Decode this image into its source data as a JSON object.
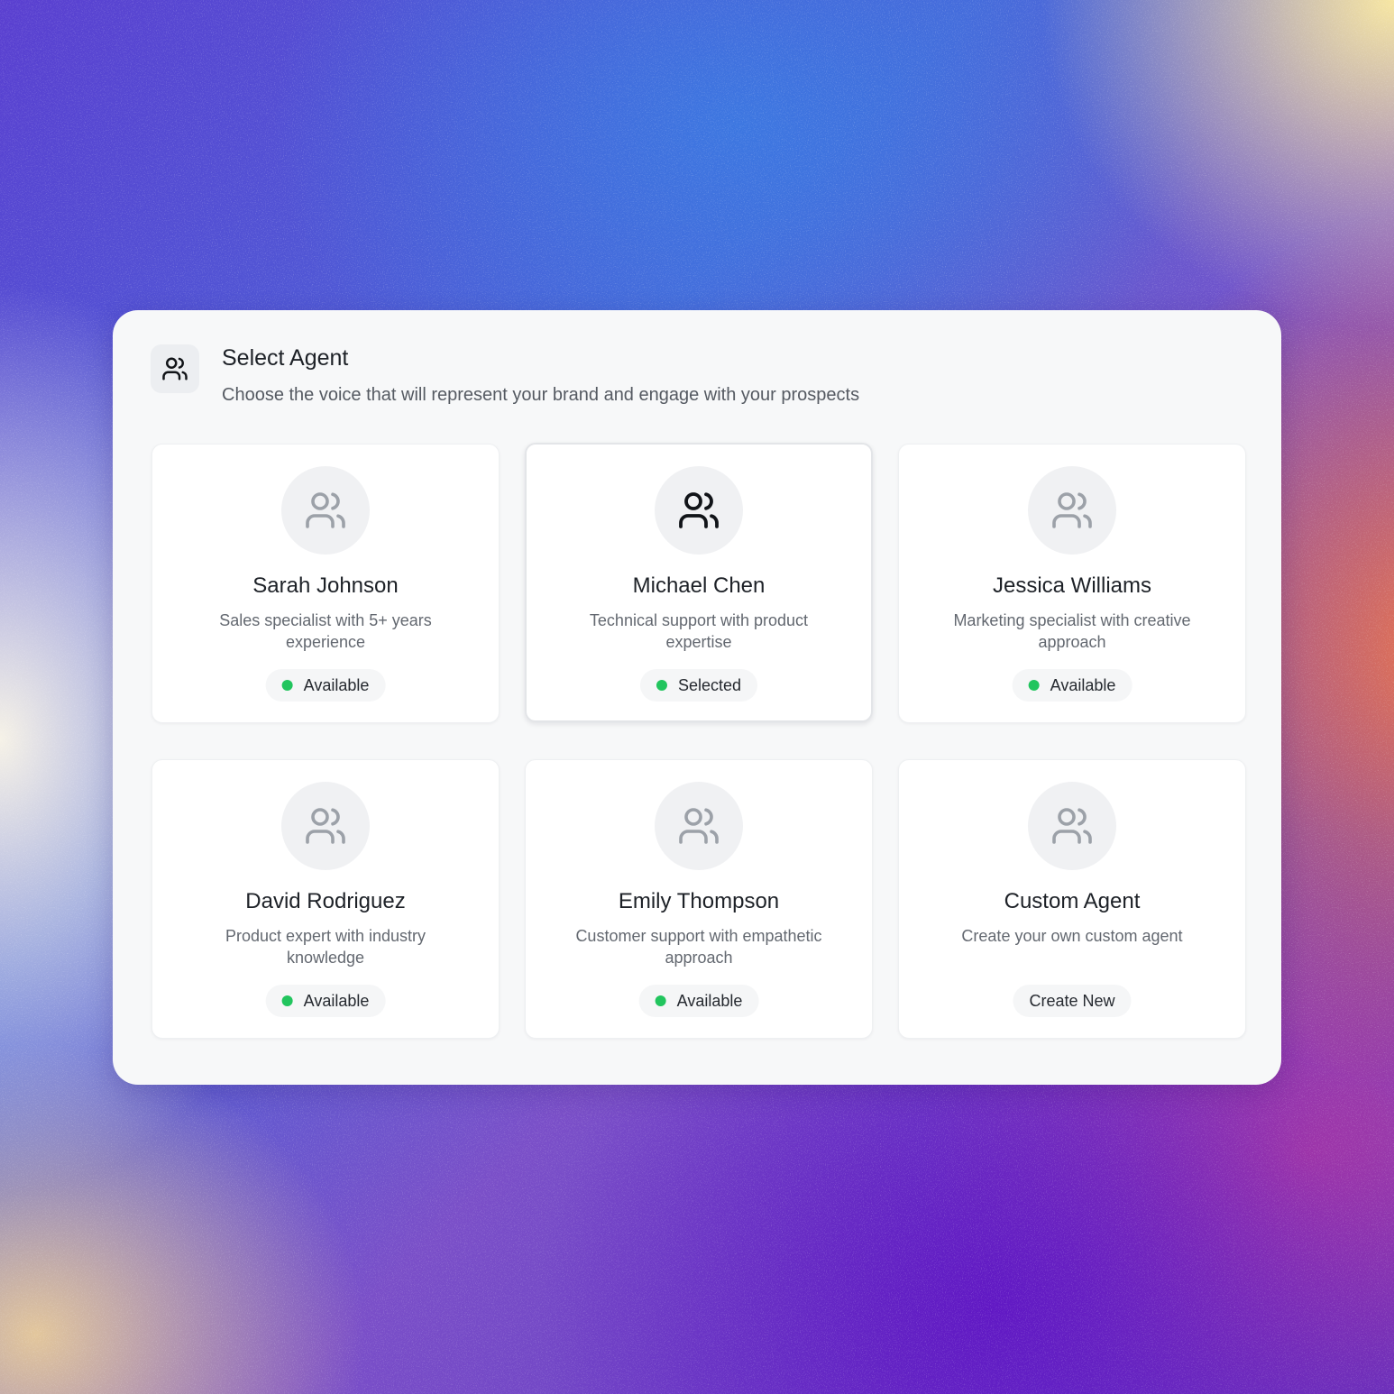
{
  "header": {
    "icon": "users-icon",
    "title": "Select Agent",
    "subtitle": "Choose the voice that will represent your brand and engage with your prospects"
  },
  "colors": {
    "status_dot": "#22c55e",
    "icon_muted": "#9ca1a8",
    "icon_active": "#111418"
  },
  "agents": [
    {
      "name": "Sarah Johnson",
      "description": "Sales specialist with 5+ years experience",
      "status": "Available",
      "icon": "users-icon",
      "selected": false
    },
    {
      "name": "Michael Chen",
      "description": "Technical support with product expertise",
      "status": "Selected",
      "icon": "users-icon",
      "selected": true
    },
    {
      "name": "Jessica Williams",
      "description": "Marketing specialist with creative approach",
      "status": "Available",
      "icon": "users-icon",
      "selected": false
    },
    {
      "name": "David Rodriguez",
      "description": "Product expert with industry knowledge",
      "status": "Available",
      "icon": "users-icon",
      "selected": false
    },
    {
      "name": "Emily Thompson",
      "description": "Customer support with empathetic approach",
      "status": "Available",
      "icon": "users-icon",
      "selected": false
    },
    {
      "name": "Custom Agent",
      "description": "Create your own custom agent",
      "status": "Create New",
      "icon": "users-icon",
      "selected": false
    }
  ]
}
